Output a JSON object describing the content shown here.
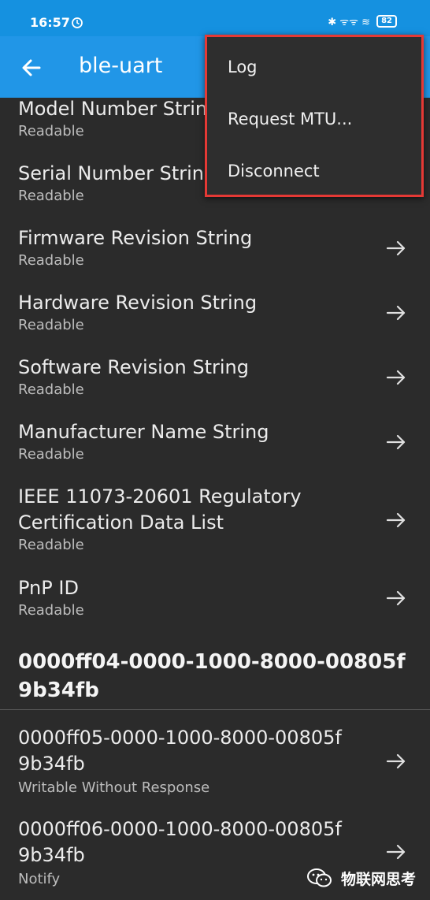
{
  "status_bar": {
    "time": "16:57",
    "right_text": "✱ ᯤᯤ ≋",
    "battery": "82"
  },
  "app_bar": {
    "title": "ble-uart"
  },
  "characteristics": [
    {
      "title": "Model Number String",
      "sub": "Readable"
    },
    {
      "title": "Serial Number String",
      "sub": "Readable"
    },
    {
      "title": "Firmware Revision String",
      "sub": "Readable"
    },
    {
      "title": "Hardware Revision String",
      "sub": "Readable"
    },
    {
      "title": "Software Revision String",
      "sub": "Readable"
    },
    {
      "title": "Manufacturer Name String",
      "sub": "Readable"
    },
    {
      "title_line1": "IEEE 11073-20601 Regulatory",
      "title_line2": "Certification Data List",
      "sub": "Readable"
    },
    {
      "title": "PnP ID",
      "sub": "Readable"
    }
  ],
  "service": {
    "line1": "0000ff04-0000-1000-8000-00805f",
    "line2": "9b34fb"
  },
  "service_characteristics": [
    {
      "line1": "0000ff05-0000-1000-8000-00805f",
      "line2": "9b34fb",
      "sub": "Writable Without Response"
    },
    {
      "line1": "0000ff06-0000-1000-8000-00805f",
      "line2": "9b34fb",
      "sub": "Notify"
    }
  ],
  "menu": {
    "items": [
      "Log",
      "Request MTU...",
      "Disconnect"
    ]
  },
  "watermark": {
    "text": "物联网思考"
  },
  "colors": {
    "app_bar": "#2196e7",
    "background": "#2b2b2b",
    "highlight": "#e53935"
  }
}
